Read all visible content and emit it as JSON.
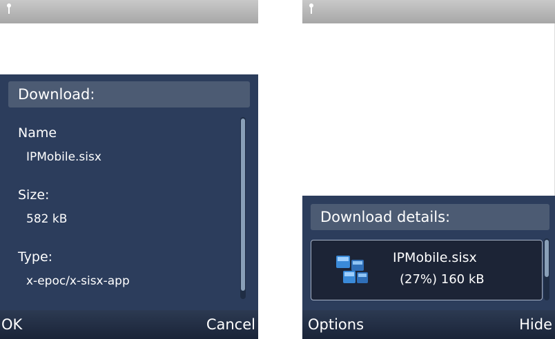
{
  "left_screen": {
    "dialog_title": "Download:",
    "fields": [
      {
        "label": "Name",
        "value": "IPMobile.sisx"
      },
      {
        "label": "Size:",
        "value": "582 kB"
      },
      {
        "label": "Type:",
        "value": "x-epoc/x-sisx-app"
      }
    ],
    "softkeys": {
      "left": "OK",
      "right": "Cancel"
    }
  },
  "right_screen": {
    "dialog_title": "Download details:",
    "download": {
      "file_name": "IPMobile.sisx",
      "progress_text": "(27%) 160 kB",
      "progress_percent": 27
    },
    "softkeys": {
      "left": "Options",
      "right": "Hide"
    }
  },
  "icons": [
    "signal-icon",
    "app-package-icon"
  ],
  "colors": {
    "dialog_bg": "#2c3d5c",
    "header_bg": "#4c5b73",
    "softkey_bg": "#1a2438"
  }
}
